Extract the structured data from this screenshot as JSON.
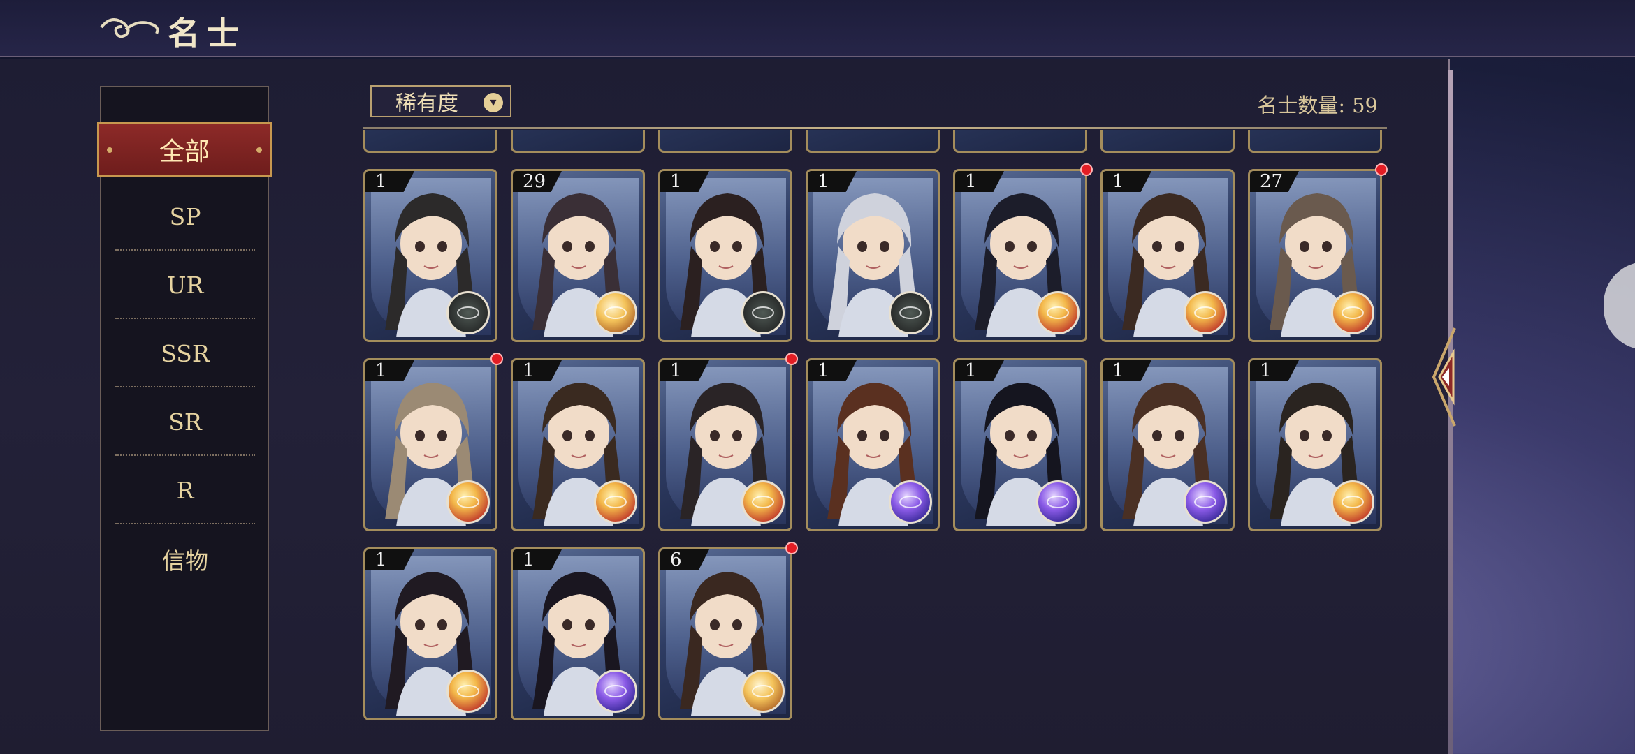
{
  "header": {
    "title": "名士",
    "emblem_icon": "cloud-swirl-icon"
  },
  "sidebar": {
    "active": "全部",
    "items": [
      "SP",
      "UR",
      "SSR",
      "SR",
      "R",
      "信物"
    ]
  },
  "filter": {
    "label": "稀有度",
    "icon": "chevron-down-icon"
  },
  "count": {
    "label": "名士数量:",
    "value": "59"
  },
  "colors": {
    "accent_red": "#8d2a28",
    "gold_text": "#e6d3a0",
    "notification": "#e31d24"
  },
  "cards": [
    {
      "level": "1",
      "badge": "dark",
      "notify": false
    },
    {
      "level": "29",
      "badge": "orange",
      "notify": false
    },
    {
      "level": "1",
      "badge": "dark",
      "notify": false
    },
    {
      "level": "1",
      "badge": "dark",
      "notify": false
    },
    {
      "level": "1",
      "badge": "gold",
      "notify": true
    },
    {
      "level": "1",
      "badge": "gold",
      "notify": false
    },
    {
      "level": "27",
      "badge": "gold",
      "notify": true
    },
    {
      "level": "1",
      "badge": "gold",
      "notify": true
    },
    {
      "level": "1",
      "badge": "gold",
      "notify": false
    },
    {
      "level": "1",
      "badge": "gold",
      "notify": true
    },
    {
      "level": "1",
      "badge": "purple",
      "notify": false
    },
    {
      "level": "1",
      "badge": "purple",
      "notify": false
    },
    {
      "level": "1",
      "badge": "purple",
      "notify": false
    },
    {
      "level": "1",
      "badge": "gold",
      "notify": false
    },
    {
      "level": "1",
      "badge": "gold",
      "notify": false
    },
    {
      "level": "1",
      "badge": "purple",
      "notify": false
    },
    {
      "level": "6",
      "badge": "orange",
      "notify": true
    }
  ]
}
